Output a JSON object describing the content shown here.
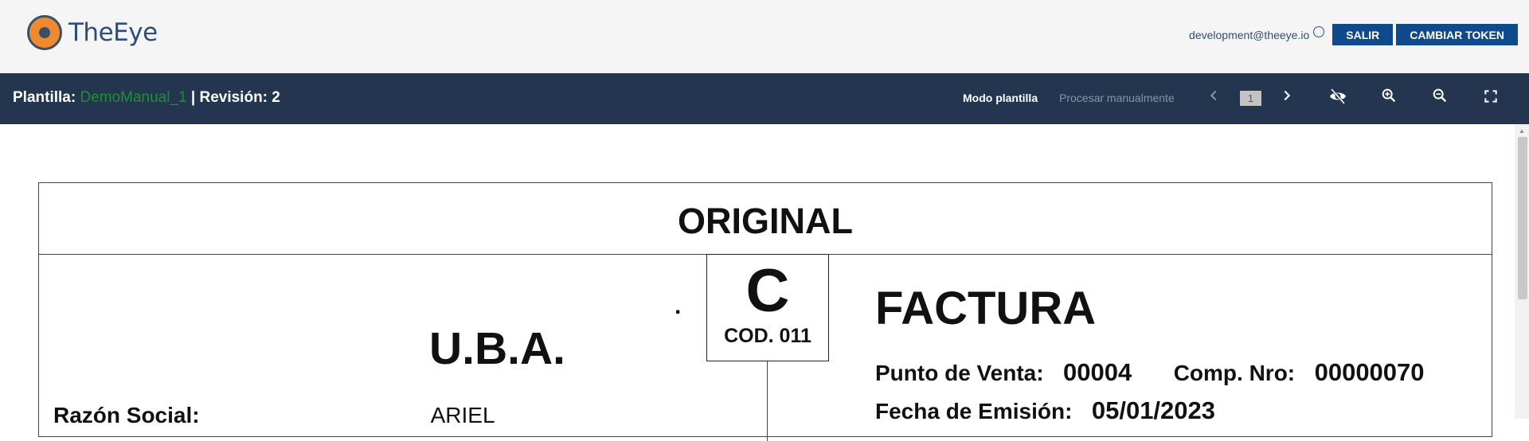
{
  "header": {
    "app_name": "TheEye",
    "user_email": "development@theeye.io",
    "logout_label": "SALIR",
    "change_token_label": "CAMBIAR TOKEN"
  },
  "toolbar": {
    "template_label": "Plantilla:",
    "template_name": "DemoManual_1",
    "revision_text": "| Revisión: 2",
    "mode_label": "Modo plantilla",
    "manual_label": "Procesar manualmente",
    "page_number": "1",
    "icons": [
      "chevron-left-icon",
      "chevron-right-icon",
      "visibility-off-icon",
      "zoom-in-icon",
      "zoom-out-icon",
      "fullscreen-icon"
    ]
  },
  "document": {
    "copy_label": "ORIGINAL",
    "invoice_letter": "C",
    "invoice_code": "COD. 011",
    "dot": ".",
    "issuer_name": "U.B.A.",
    "razon_social_label": "Razón Social:",
    "razon_social_value": "ARIEL",
    "doc_type": "FACTURA",
    "punto_venta_label": "Punto de Venta:",
    "punto_venta_value": "00004",
    "comp_nro_label": "Comp. Nro:",
    "comp_nro_value": "00000070",
    "fecha_label": "Fecha de Emisión:",
    "fecha_value": "05/01/2023"
  },
  "colors": {
    "header_bg": "#f5f5f5",
    "toolbar_bg": "#243550",
    "button_bg": "#0f4a8a",
    "template_name": "#1e8f34",
    "logo_orange": "#ee8a32"
  }
}
